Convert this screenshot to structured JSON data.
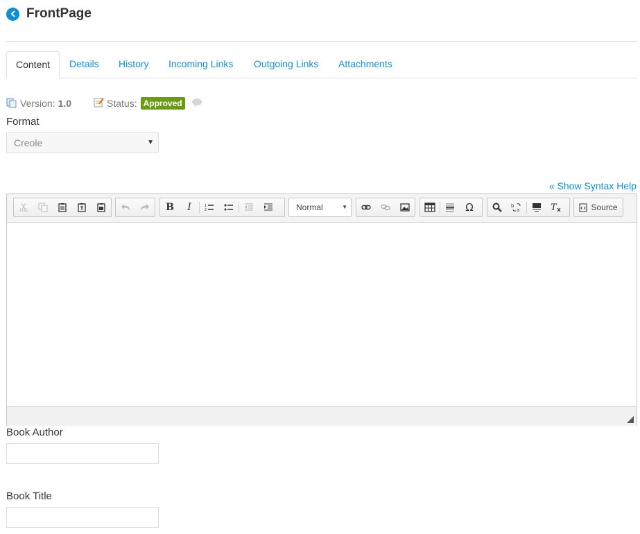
{
  "header": {
    "title": "FrontPage",
    "back_icon": "chevron-left-icon",
    "accent": "#0b8fd8"
  },
  "tabs": [
    {
      "label": "Content",
      "active": true
    },
    {
      "label": "Details",
      "active": false
    },
    {
      "label": "History",
      "active": false
    },
    {
      "label": "Incoming Links",
      "active": false
    },
    {
      "label": "Outgoing Links",
      "active": false
    },
    {
      "label": "Attachments",
      "active": false
    }
  ],
  "meta": {
    "version_label": "Version:",
    "version_value": "1.0",
    "status_label": "Status:",
    "status_value": "Approved",
    "status_color": "#6b9b16"
  },
  "format": {
    "label": "Format",
    "selected": "Creole"
  },
  "editor": {
    "syntax_help": "« Show Syntax Help",
    "format_combo": "Normal",
    "source_label": "Source",
    "toolbar_icons": [
      "cut-icon",
      "copy-icon",
      "paste-icon",
      "paste-text-icon",
      "paste-word-icon",
      "undo-icon",
      "redo-icon",
      "bold-icon",
      "italic-icon",
      "numbered-list-icon",
      "bulleted-list-icon",
      "outdent-icon",
      "indent-icon",
      "link-icon",
      "unlink-icon",
      "image-icon",
      "table-icon",
      "horizontal-line-icon",
      "special-char-icon",
      "find-icon",
      "replace-icon",
      "select-all-icon",
      "remove-format-icon",
      "source-icon"
    ]
  },
  "fields": {
    "book_author_label": "Book Author",
    "book_author_value": "",
    "book_title_label": "Book Title",
    "book_title_value": ""
  }
}
